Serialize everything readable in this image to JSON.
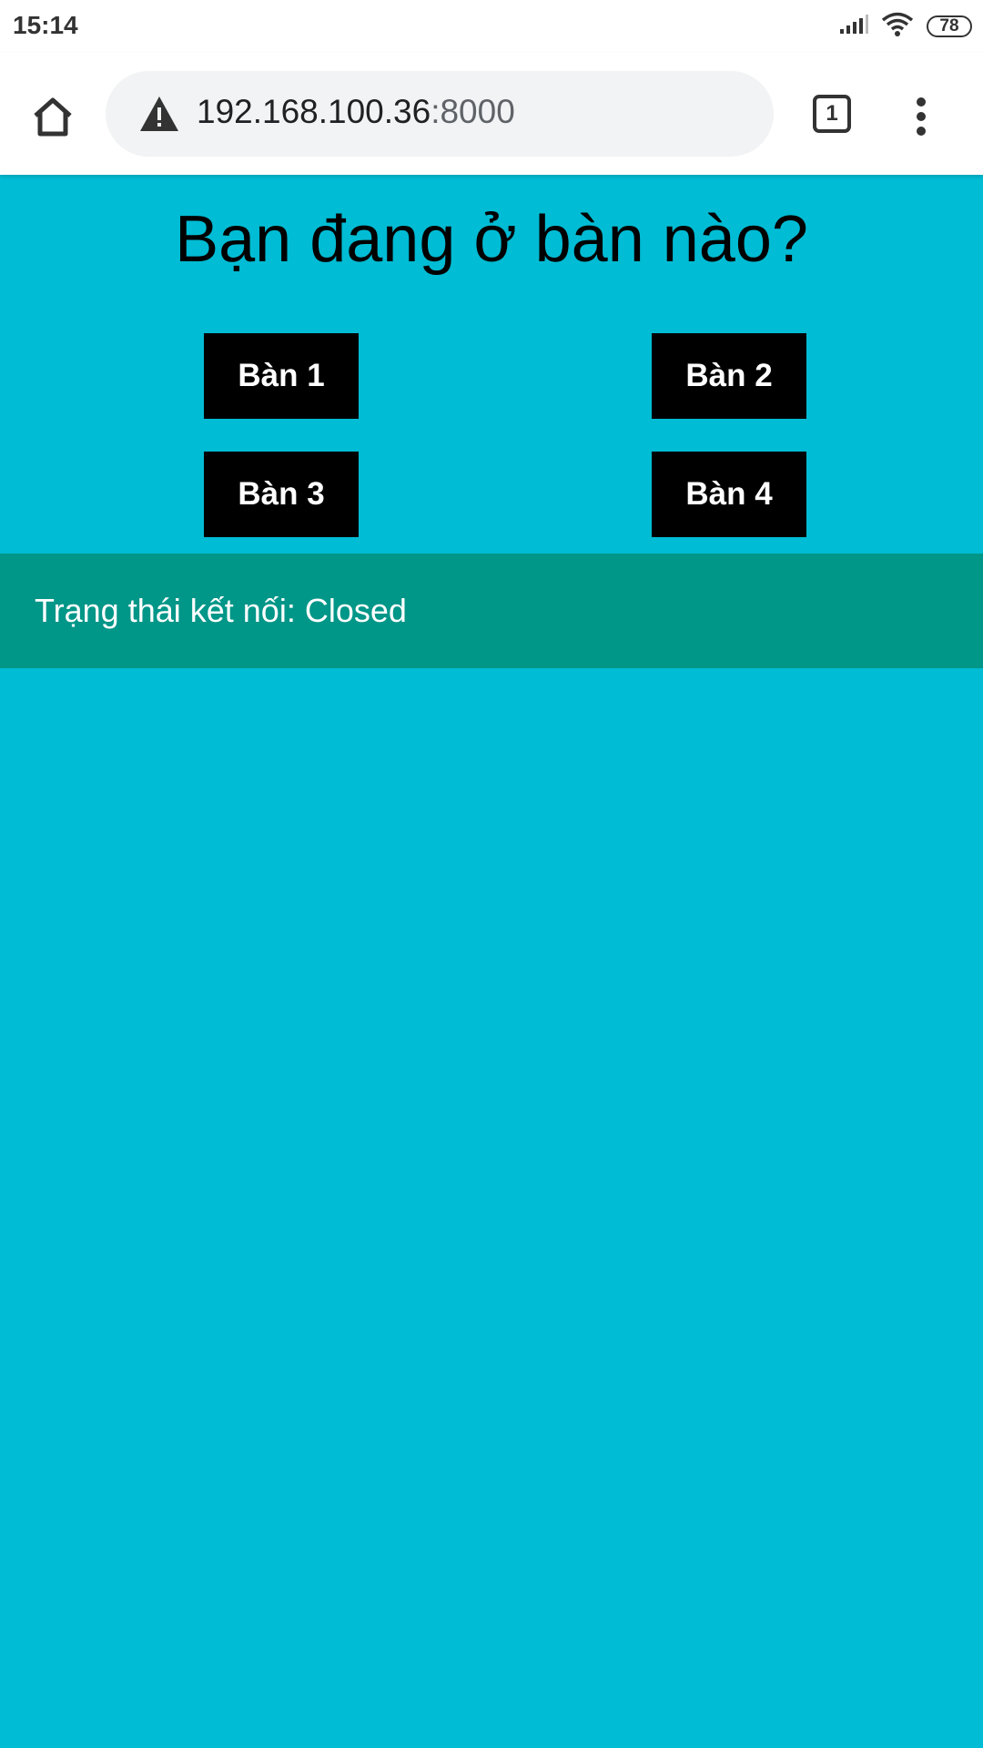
{
  "status_bar": {
    "time": "15:14",
    "battery": "78",
    "icons": [
      "signal-icon",
      "wifi-icon",
      "battery-icon"
    ]
  },
  "browser": {
    "url_host": "192.168.100.36",
    "url_port": ":8000",
    "tab_count": "1",
    "icons": [
      "home-icon",
      "warning-icon",
      "tabs-icon",
      "more-vert-icon"
    ]
  },
  "page": {
    "title": "Bạn đang ở bàn nào?",
    "tables": [
      "Bàn 1",
      "Bàn 2",
      "Bàn 3",
      "Bàn 4"
    ],
    "connection_status": "Trạng thái kết nối: Closed"
  },
  "colors": {
    "page_background": "#00BCD4",
    "status_panel": "#009688",
    "button_background": "#000000",
    "button_text": "#FFFFFF"
  }
}
